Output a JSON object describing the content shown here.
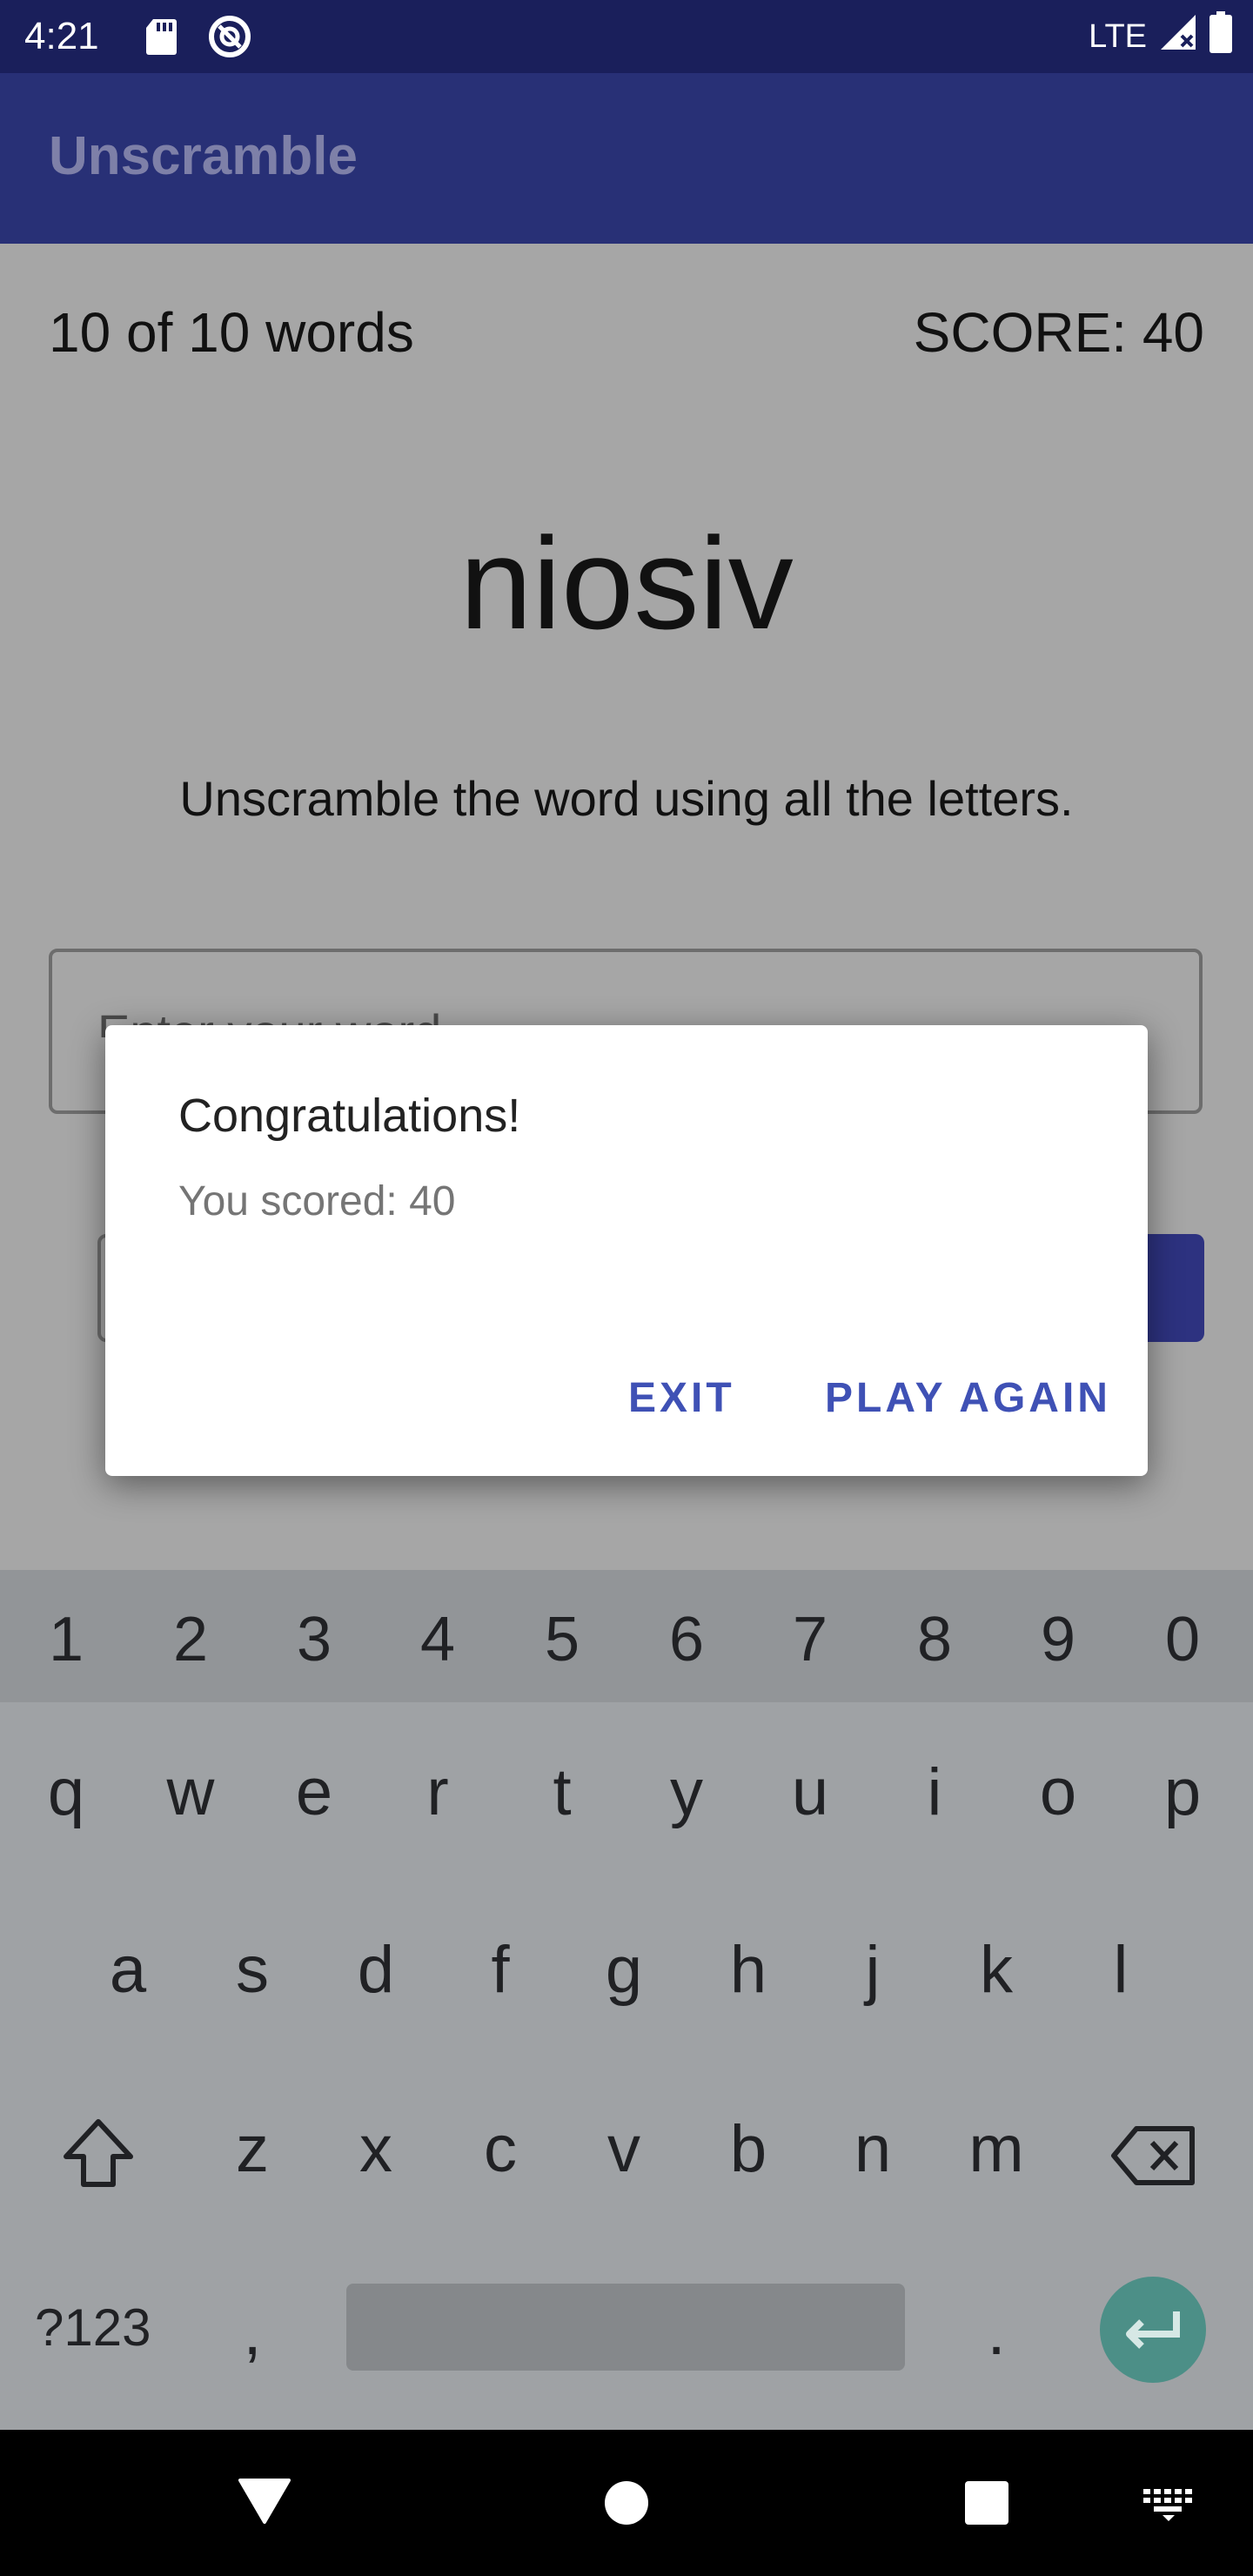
{
  "status_bar": {
    "time": "4:21",
    "network": "LTE"
  },
  "app_bar": {
    "title": "Unscramble"
  },
  "game": {
    "word_count": "10 of 10 words",
    "score": "SCORE: 40",
    "scrambled_word": "niosiv",
    "instructions": "Unscramble the word using all the letters.",
    "input_placeholder": "Enter your word"
  },
  "dialog": {
    "title": "Congratulations!",
    "message": "You scored: 40",
    "exit_label": "EXIT",
    "play_again_label": "PLAY AGAIN"
  },
  "keyboard": {
    "numbers": [
      "1",
      "2",
      "3",
      "4",
      "5",
      "6",
      "7",
      "8",
      "9",
      "0"
    ],
    "row1": [
      "q",
      "w",
      "e",
      "r",
      "t",
      "y",
      "u",
      "i",
      "o",
      "p"
    ],
    "row2": [
      "a",
      "s",
      "d",
      "f",
      "g",
      "h",
      "j",
      "k",
      "l"
    ],
    "row3": [
      "z",
      "x",
      "c",
      "v",
      "b",
      "n",
      "m"
    ],
    "symbols_label": "?123",
    "comma": ",",
    "period": "."
  },
  "colors": {
    "status_bar": "#1a1f5b",
    "app_bar": "#283076",
    "accent": "#3f51b5",
    "enter_key": "#4c8f87"
  }
}
